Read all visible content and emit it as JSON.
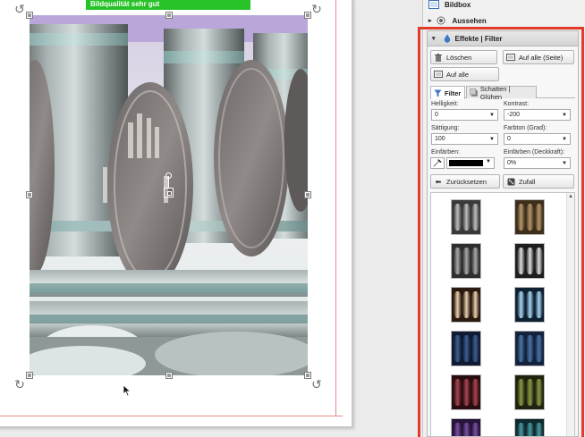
{
  "canvas": {
    "quality_banner": "Bildqualität sehr gut"
  },
  "panel": {
    "bildbox_label": "Bildbox",
    "aussehen_label": "Aussehen",
    "effects": {
      "title": "Effekte | Filter",
      "btn_delete": "Löschen",
      "btn_apply_all_page": "Auf alle (Seite)",
      "btn_apply_all": "Auf alle",
      "tab_filter": "Filter",
      "tab_shadow": "Schatten | Glühen",
      "brightness_label": "Helligkeit:",
      "brightness_value": "0",
      "contrast_label": "Kontrast:",
      "contrast_value": "-200",
      "saturation_label": "Sättigung:",
      "saturation_value": "100",
      "hue_label": "Farbton (Grad):",
      "hue_value": "0",
      "tint_label": "Einfärben:",
      "tint_color": "#000000",
      "tint_opacity_label": "Einfärben (Deckkraft):",
      "tint_opacity_value": "0%",
      "btn_reset": "Zurücksetzen",
      "btn_random": "Zufall",
      "presets": [
        {
          "name": "original",
          "bg": "#3a3a3a",
          "barrel": "#bdbdbd"
        },
        {
          "name": "sepia",
          "bg": "#3d2f1c",
          "barrel": "#b79868"
        },
        {
          "name": "grayscale",
          "bg": "#2e2e2e",
          "barrel": "#a8a8a8"
        },
        {
          "name": "high-contrast",
          "bg": "#1e1e1e",
          "barrel": "#e0e0e0"
        },
        {
          "name": "warm",
          "bg": "#2b1a10",
          "barrel": "#e7cfae"
        },
        {
          "name": "cool-invert",
          "bg": "#0e2233",
          "barrel": "#a9d6f0"
        },
        {
          "name": "navy",
          "bg": "#101a33",
          "barrel": "#3d5f8f"
        },
        {
          "name": "blue",
          "bg": "#13233d",
          "barrel": "#4d74a6"
        },
        {
          "name": "red",
          "bg": "#2a0d10",
          "barrel": "#a94450"
        },
        {
          "name": "olive",
          "bg": "#1f2410",
          "barrel": "#8e9a44"
        },
        {
          "name": "purple",
          "bg": "#26143a",
          "barrel": "#7a4fa3"
        },
        {
          "name": "teal",
          "bg": "#0f2a2e",
          "barrel": "#4a9aa0"
        }
      ]
    }
  }
}
